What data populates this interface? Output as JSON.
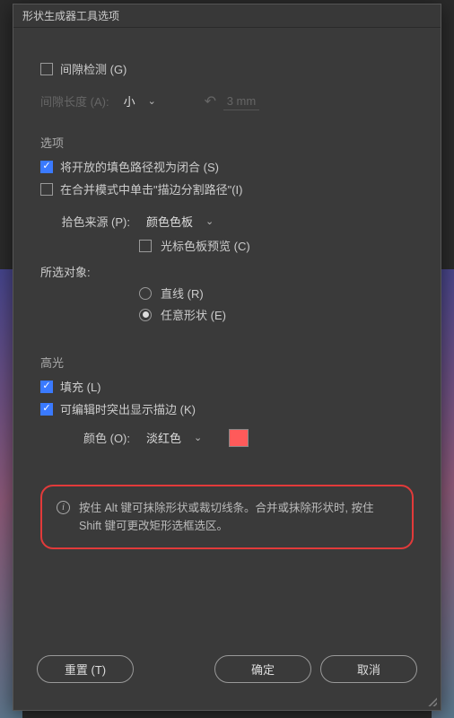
{
  "title": "形状生成器工具选项",
  "gap": {
    "detection_label": "间隙检测 (G)",
    "detection_checked": false,
    "length_label": "间隙长度 (A):",
    "small": "小",
    "value": "3 mm"
  },
  "options": {
    "heading": "选项",
    "open_as_closed_label": "将开放的填色路径视为闭合 (S)",
    "open_as_closed_checked": true,
    "merge_click_label": "在合并模式中单击\"描边分割路径\"(I)",
    "merge_click_checked": false,
    "pick_source_label": "拾色来源 (P):",
    "pick_source_value": "颜色色板",
    "cursor_preview_label": "光标色板预览 (C)",
    "cursor_preview_checked": false,
    "selected_heading": "所选对象:",
    "radio_line_label": "直线 (R)",
    "radio_any_label": "任意形状 (E)",
    "radio_any_selected": true
  },
  "highlight": {
    "heading": "高光",
    "fill_label": "填充 (L)",
    "fill_checked": true,
    "stroke_edit_label": "可编辑时突出显示描边 (K)",
    "stroke_edit_checked": true,
    "color_label": "颜色 (O):",
    "color_value": "淡红色",
    "swatch": "#ff5a5a"
  },
  "info_text": "按住 Alt 键可抹除形状或裁切线条。合并或抹除形状时, 按住 Shift 键可更改矩形选框选区。",
  "buttons": {
    "reset": "重置 (T)",
    "ok": "确定",
    "cancel": "取消"
  }
}
